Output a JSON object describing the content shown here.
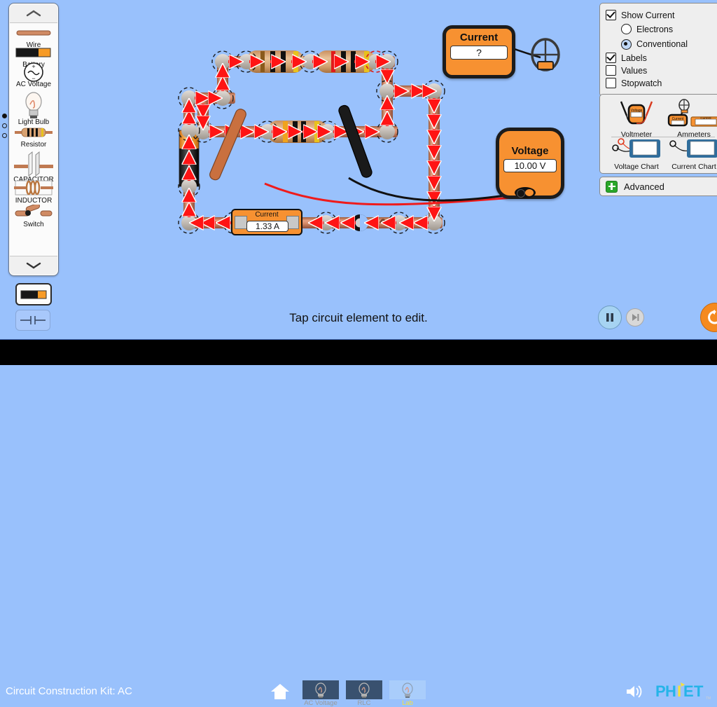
{
  "app": {
    "title": "Circuit Construction Kit: AC",
    "background_color": "#99c1fc",
    "hint": "Tap circuit element to edit."
  },
  "carousel": {
    "up_arrow_icon": "chevron-up-icon",
    "down_arrow_icon": "chevron-down-icon",
    "page_dots": 3,
    "active_page": 1,
    "items": [
      {
        "label": "Wire",
        "icon": "wire-icon"
      },
      {
        "label": "Battery",
        "icon": "battery-icon"
      },
      {
        "label": "AC Voltage",
        "icon": "ac-voltage-icon"
      },
      {
        "label": "Light Bulb",
        "icon": "light-bulb-icon"
      },
      {
        "label": "Resistor",
        "icon": "resistor-icon"
      },
      {
        "label": "CAPACITOR",
        "icon": "capacitor-icon"
      },
      {
        "label": "INDUCTOR",
        "icon": "inductor-icon"
      },
      {
        "label": "Switch",
        "icon": "switch-icon"
      }
    ]
  },
  "view_toggle": {
    "lifelike": {
      "name": "lifelike-view",
      "selected": true
    },
    "schematic": {
      "name": "schematic-view",
      "selected": false
    }
  },
  "display_panel": {
    "show_current": {
      "label": "Show Current",
      "checked": true
    },
    "electrons": {
      "label": "Electrons",
      "selected": false,
      "flag": "electron-icon"
    },
    "conventional": {
      "label": "Conventional",
      "selected": true,
      "flag": "arrow-right-icon"
    },
    "labels": {
      "label": "Labels",
      "checked": true
    },
    "values": {
      "label": "Values",
      "checked": false
    },
    "stopwatch": {
      "label": "Stopwatch",
      "checked": false
    }
  },
  "sensor_toolbox": {
    "voltmeter": "Voltmeter",
    "ammeters": "Ammeters",
    "voltage_chart": "Voltage Chart",
    "current_chart": "Current Chart"
  },
  "advanced_panel": {
    "label": "Advanced",
    "expand_icon": "plus-icon"
  },
  "meters": {
    "noncontact_ammeter": {
      "title": "Current",
      "value": "?"
    },
    "voltmeter": {
      "title": "Voltage",
      "value": "10.00 V"
    },
    "series_ammeter": {
      "title": "Current",
      "value": "1.33 A"
    }
  },
  "sim_controls": {
    "pause": {
      "icon": "pause-icon",
      "active": true
    },
    "step": {
      "icon": "step-forward-icon",
      "active": false
    },
    "reset": {
      "icon": "reset-icon"
    }
  },
  "nav_bar": {
    "home": "home-icon",
    "sound": "sound-icon",
    "logo": "phet-logo",
    "screens": [
      {
        "label": "AC Voltage",
        "selected": false
      },
      {
        "label": "RLC",
        "selected": false
      },
      {
        "label": "Lab",
        "selected": true
      }
    ]
  },
  "colors": {
    "accent_orange": "#f79131",
    "current_arrow": "#ff1a1a",
    "wire_copper": "#c57b53",
    "panel_grey": "#eeeeee",
    "selected_tab_text": "#f5e03c"
  }
}
